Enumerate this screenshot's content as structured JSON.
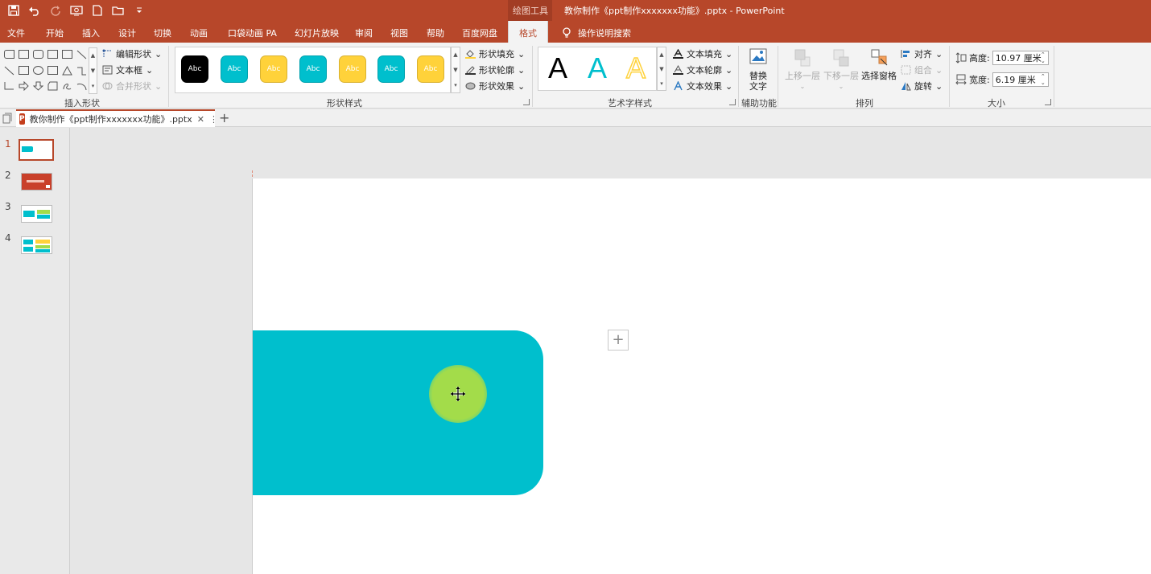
{
  "titlebar": {
    "context_tool": "绘图工具",
    "doc_title": "教你制作《ppt制作xxxxxxx功能》.pptx  -  PowerPoint"
  },
  "tabs": {
    "file": "文件",
    "home": "开始",
    "insert": "插入",
    "design": "设计",
    "transitions": "切换",
    "animations": "动画",
    "pocket": "口袋动画 PA",
    "slideshow": "幻灯片放映",
    "review": "审阅",
    "view": "视图",
    "help": "帮助",
    "baidu": "百度网盘",
    "format": "格式",
    "tellme": "操作说明搜索"
  },
  "ribbon": {
    "insert_shapes": {
      "label": "插入形状",
      "edit_shape": "编辑形状",
      "text_box": "文本框",
      "merge_shapes": "合并形状"
    },
    "shape_styles": {
      "label": "形状样式",
      "chips": [
        {
          "text": "Abc",
          "fill": "#000000",
          "fg": "#ffffff"
        },
        {
          "text": "Abc",
          "fill": "#00bfcd",
          "fg": "#ffffff"
        },
        {
          "text": "Abc",
          "fill": "#ffd23a",
          "fg": "#ffffff"
        },
        {
          "text": "Abc",
          "fill": "#00bfcd",
          "fg": "#ffffff"
        },
        {
          "text": "Abc",
          "fill": "#ffd23a",
          "fg": "#ffffff"
        },
        {
          "text": "Abc",
          "fill": "#00bfcd",
          "fg": "#ffffff"
        },
        {
          "text": "Abc",
          "fill": "#ffd23a",
          "fg": "#ffffff"
        }
      ],
      "fill": "形状填充",
      "outline": "形状轮廓",
      "effects": "形状效果"
    },
    "wordart": {
      "label": "艺术字样式",
      "samples": [
        "A",
        "A",
        "A"
      ],
      "text_fill": "文本填充",
      "text_outline": "文本轮廓",
      "text_effects": "文本效果"
    },
    "accessibility": {
      "label": "辅助功能",
      "alt_text": "替换\n文字"
    },
    "arrange": {
      "label": "排列",
      "bring_forward": "上移一层",
      "send_backward": "下移一层",
      "selection_pane": "选择窗格",
      "align": "对齐",
      "group": "组合",
      "rotate": "旋转"
    },
    "size": {
      "label": "大小",
      "height_label": "高度:",
      "height_value": "10.97 厘米",
      "width_label": "宽度:",
      "width_value": "6.19 厘米"
    }
  },
  "doc_tab": {
    "title": "教你制作《ppt制作xxxxxxx功能》.pptx",
    "close": "✕",
    "more": "⋮",
    "add": "+"
  },
  "slides": [
    {
      "num": "1",
      "selected": true
    },
    {
      "num": "2",
      "selected": false
    },
    {
      "num": "3",
      "selected": false
    },
    {
      "num": "4",
      "selected": false
    }
  ],
  "colors": {
    "brand": "#b7472a",
    "teal": "#00bfcd",
    "yellow": "#ffd23a",
    "green": "#a3dc4a"
  }
}
